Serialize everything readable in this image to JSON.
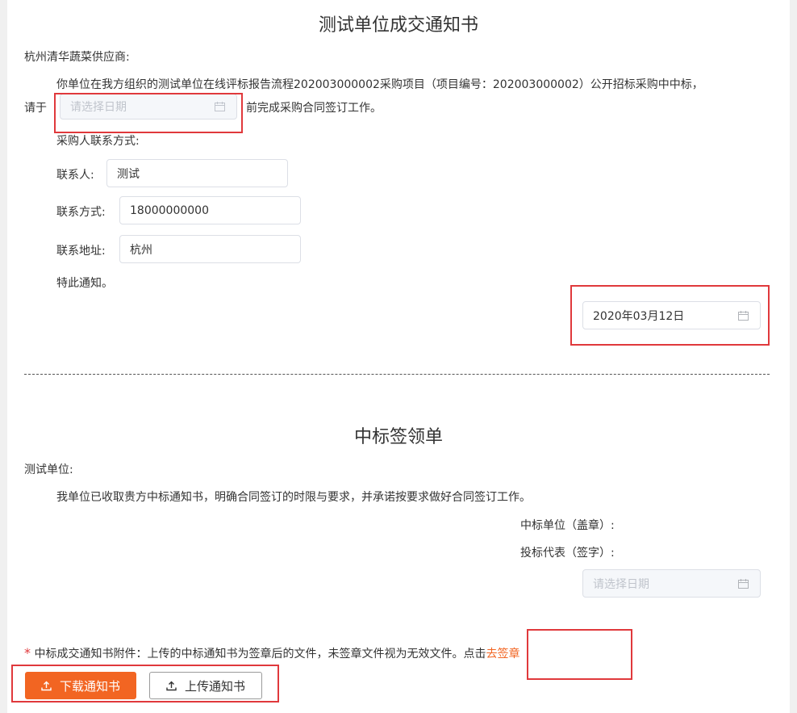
{
  "notice": {
    "title": "测试单位成交通知书",
    "addressee": "杭州清华蔬菜供应商:",
    "body_line1": "你单位在我方组织的测试单位在线评标报告流程202003000002采购项目（项目编号：202003000002）公开招标采购中中标，",
    "body_prefix": "请于",
    "deadline_placeholder": "请选择日期",
    "body_suffix": "前完成采购合同签订工作。",
    "contact_heading": "采购人联系方式:",
    "contact_person_label": "联系人:",
    "contact_person_value": "测试",
    "contact_phone_label": "联系方式:",
    "contact_phone_value": "18000000000",
    "contact_address_label": "联系地址:",
    "contact_address_value": "杭州",
    "closing": "特此通知。",
    "notice_date": "2020年03月12日"
  },
  "receipt": {
    "title": "中标签领单",
    "addressee": "测试单位:",
    "body": "我单位已收取贵方中标通知书，明确合同签订的时限与要求，并承诺按要求做好合同签订工作。",
    "seal_label": "中标单位（盖章）:",
    "rep_label": "投标代表（签字）:",
    "date_placeholder": "请选择日期"
  },
  "attachment": {
    "required_mark": "*",
    "note": "中标成交通知书附件：上传的中标通知书为签章后的文件，未签章文件视为无效文件。点击",
    "sign_link": "去签章"
  },
  "actions": {
    "download_label": "下载通知书",
    "upload_label": "上传通知书"
  },
  "colors": {
    "accent": "#f26522",
    "highlight": "#e0393c"
  }
}
